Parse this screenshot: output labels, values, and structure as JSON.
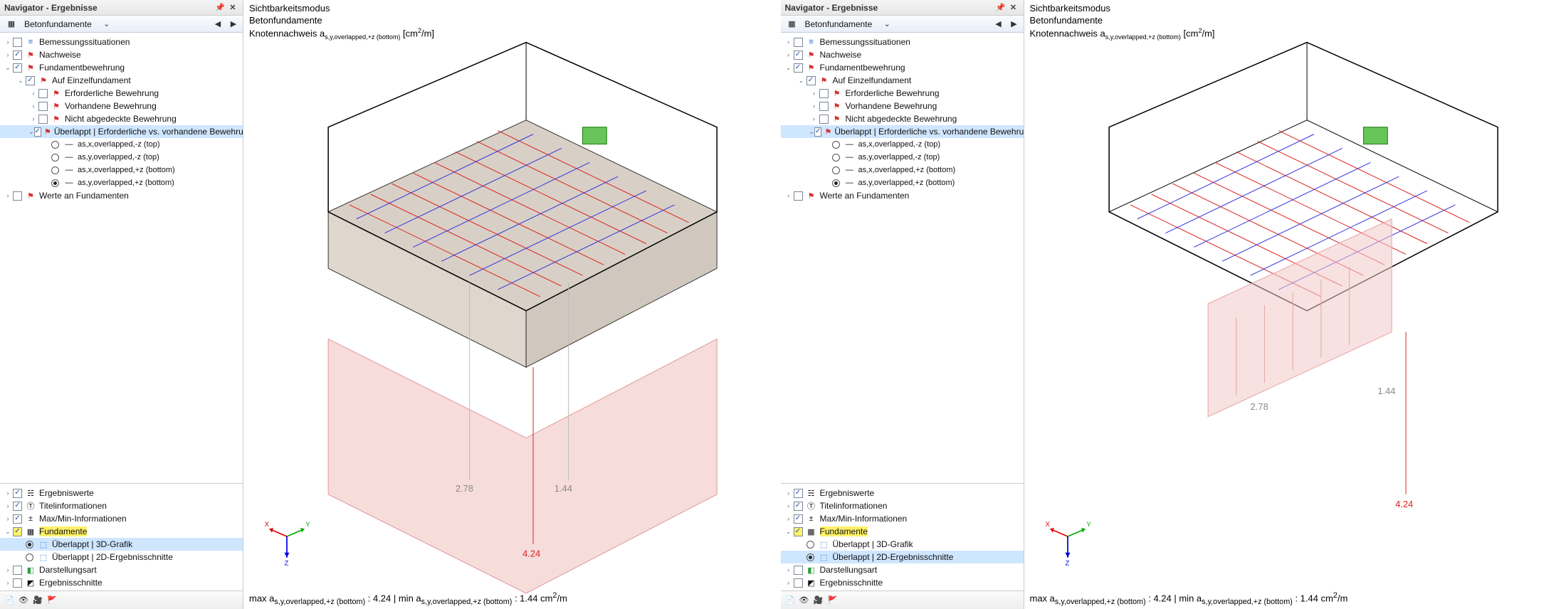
{
  "left": {
    "nav_title": "Navigator - Ergebnisse",
    "combo_label": "Betonfundamente",
    "tree": {
      "bemessung": "Bemessungssituationen",
      "nachweise": "Nachweise",
      "fundbew": "Fundamentbewehrung",
      "auf_einzel": "Auf Einzelfundament",
      "erf_bew": "Erforderliche Bewehrung",
      "vorh_bew": "Vorhandene Bewehrung",
      "nicht_abg": "Nicht abgedeckte Bewehrung",
      "uberlappt": "Überlappt | Erforderliche vs. vorhandene Bewehrung",
      "r1": "as,x,overlapped,-z (top)",
      "r2": "as,y,overlapped,-z (top)",
      "r3": "as,x,overlapped,+z (bottom)",
      "r4": "as,y,overlapped,+z (bottom)",
      "werte": "Werte an Fundamenten"
    },
    "lower": {
      "erg": "Ergebniswerte",
      "titel": "Titelinformationen",
      "mm": "Max/Min-Informationen",
      "fund": "Fundamente",
      "g3d": "Überlappt | 3D-Grafik",
      "g2d": "Überlappt | 2D-Ergebnisschnitte",
      "darst": "Darstellungsart",
      "ergsc": "Ergebnisschnitte"
    },
    "viewport": {
      "t1": "Sichtbarkeitsmodus",
      "t2": "Betonfundamente",
      "t3_pre": "Knotennachweis a",
      "t3_sub": "s,y,overlapped,+z (bottom)",
      "t3_unit_pre": " [cm",
      "t3_unit_sup": "2",
      "t3_unit_post": "/m]",
      "val_278": "2.78",
      "val_144": "1.44",
      "val_424": "4.24",
      "status_pre": "max a",
      "status_sub": "s,y,overlapped,+z (bottom)",
      "status_mid": " : 4.24 | min a",
      "status_sub2": "s,y,overlapped,+z (bottom)",
      "status_end": " : 1.44 cm",
      "status_sup": "2",
      "status_tail": "/m"
    },
    "triad": {
      "x": "X",
      "y": "Y",
      "z": "Z"
    }
  },
  "right": {
    "nav_title": "Navigator - Ergebnisse",
    "combo_label": "Betonfundamente",
    "viewport": {
      "t1": "Sichtbarkeitsmodus",
      "t2": "Betonfundamente",
      "t3_pre": "Knotennachweis a",
      "t3_sub": "s,y,overlapped,+z (bottom)",
      "t3_unit_pre": " [cm",
      "t3_unit_sup": "2",
      "t3_unit_post": "/m]",
      "val_278": "2.78",
      "val_144": "1.44",
      "val_424": "4.24",
      "status_pre": "max a",
      "status_sub": "s,y,overlapped,+z (bottom)",
      "status_mid": " : 4.24 | min a",
      "status_sub2": "s,y,overlapped,+z (bottom)",
      "status_end": " : 1.44 cm",
      "status_sup": "2",
      "status_tail": "/m"
    },
    "triad": {
      "x": "X",
      "y": "Y",
      "z": "Z"
    }
  },
  "chart_data": {
    "type": "table",
    "description": "Structural-engineering result values shown as leader labels on the 3D/2D foundation-reinforcement graphic",
    "quantity": "a_s,y,overlapped,+z (bottom)",
    "unit": "cm²/m",
    "points": [
      {
        "label": "2.78"
      },
      {
        "label": "1.44"
      },
      {
        "label": "4.24"
      }
    ],
    "summary": {
      "max": 4.24,
      "min": 1.44
    }
  }
}
